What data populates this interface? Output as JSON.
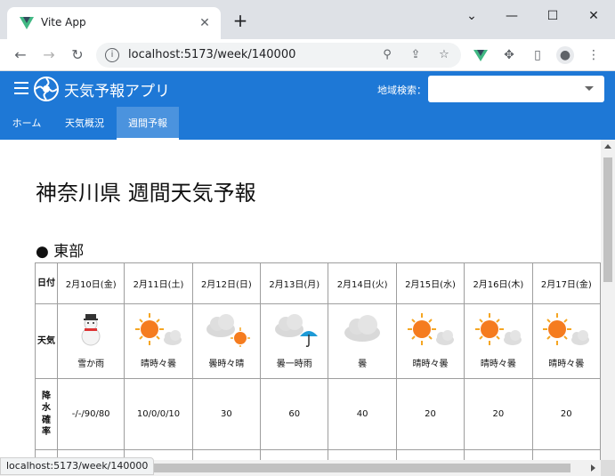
{
  "browser": {
    "tab_title": "Vite App",
    "url": "localhost:5173/week/140000",
    "status_url": "localhost:5173/week/140000",
    "vite_color": "#41b883"
  },
  "app": {
    "title": "天気予報アプリ",
    "search_label": "地域検索：",
    "region_value": "",
    "header_color": "#1e78d6",
    "nav": [
      "ホーム",
      "天気概況",
      "週間予報"
    ]
  },
  "page": {
    "title": "神奈川県 週間天気予報",
    "section": "● 東部",
    "row_labels": {
      "date": "日付",
      "weather": "天気",
      "pop": "降水確率"
    },
    "days": [
      {
        "date": "2月10日(金)",
        "weather": "雪か雨",
        "icon": "snowman-icon",
        "pop": "-/-/90/80"
      },
      {
        "date": "2月11日(土)",
        "weather": "晴時々曇",
        "icon": "sun-cloud-icon",
        "pop": "10/0/0/10"
      },
      {
        "date": "2月12日(日)",
        "weather": "曇時々晴",
        "icon": "cloud-sun-icon",
        "pop": "30"
      },
      {
        "date": "2月13日(月)",
        "weather": "曇一時雨",
        "icon": "cloud-umbrella-icon",
        "pop": "60"
      },
      {
        "date": "2月14日(火)",
        "weather": "曇",
        "icon": "cloud-icon",
        "pop": "40"
      },
      {
        "date": "2月15日(水)",
        "weather": "晴時々曇",
        "icon": "sun-cloud-icon",
        "pop": "20"
      },
      {
        "date": "2月16日(木)",
        "weather": "晴時々曇",
        "icon": "sun-cloud-icon",
        "pop": "20"
      },
      {
        "date": "2月17日(金)",
        "weather": "晴時々曇",
        "icon": "sun-cloud-icon",
        "pop": "20"
      }
    ]
  }
}
